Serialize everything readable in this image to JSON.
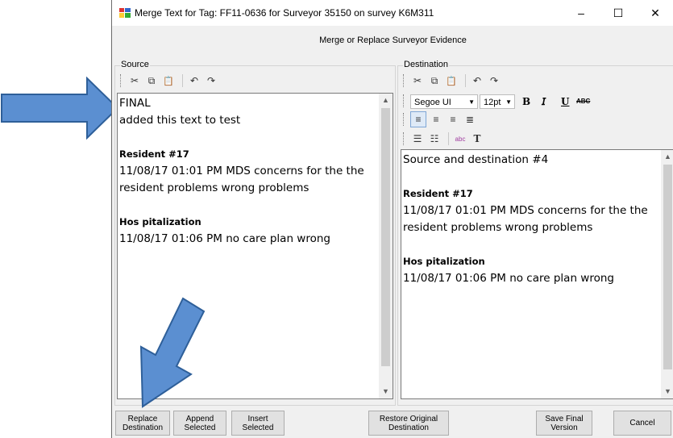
{
  "window": {
    "title": "Merge Text for Tag: FF11-0636 for Surveyor 35150 on survey K6M311",
    "minimize": "–",
    "maximize": "☐",
    "close": "✕"
  },
  "heading": "Merge or Replace Surveyor Evidence",
  "source": {
    "label": "Source",
    "lines": {
      "l1": "FINAL",
      "l2": "added this text to test",
      "h1": "Resident #17",
      "l3": "11/08/17 01:01 PM  MDS concerns for the the",
      "l4": "resident problems wrong problems",
      "h2": "Hos pitalization",
      "l5": "11/08/17 01:06 PM  no care plan wrong"
    }
  },
  "destination": {
    "label": "Destination",
    "font": "Segoe UI",
    "size": "12pt",
    "lines": {
      "l1": "Source and destination #4",
      "h1": "Resident #17",
      "l3": "11/08/17 01:01 PM  MDS concerns for the the",
      "l4": "resident problems wrong problems",
      "h2": "Hos pitalization",
      "l5": "11/08/17 01:06 PM  no care plan wrong"
    }
  },
  "toolbar_icons": {
    "cut": "✂",
    "copy": "⧉",
    "paste": "📋",
    "undo": "↶",
    "redo": "↷",
    "bold": "B",
    "italic": "𝘐",
    "underline": "U",
    "strike": "ABC",
    "bullets": "☰",
    "numbering": "☷",
    "spell": "abc",
    "text": "T"
  },
  "buttons": {
    "replace": "Replace\nDestination",
    "append": "Append\nSelected",
    "insert": "Insert\nSelected",
    "restore": "Restore Original\nDestination",
    "save": "Save Final\nVersion",
    "cancel": "Cancel"
  },
  "colors": {
    "arrow": "#5b8fd1",
    "arrow_border": "#2e5f99"
  }
}
